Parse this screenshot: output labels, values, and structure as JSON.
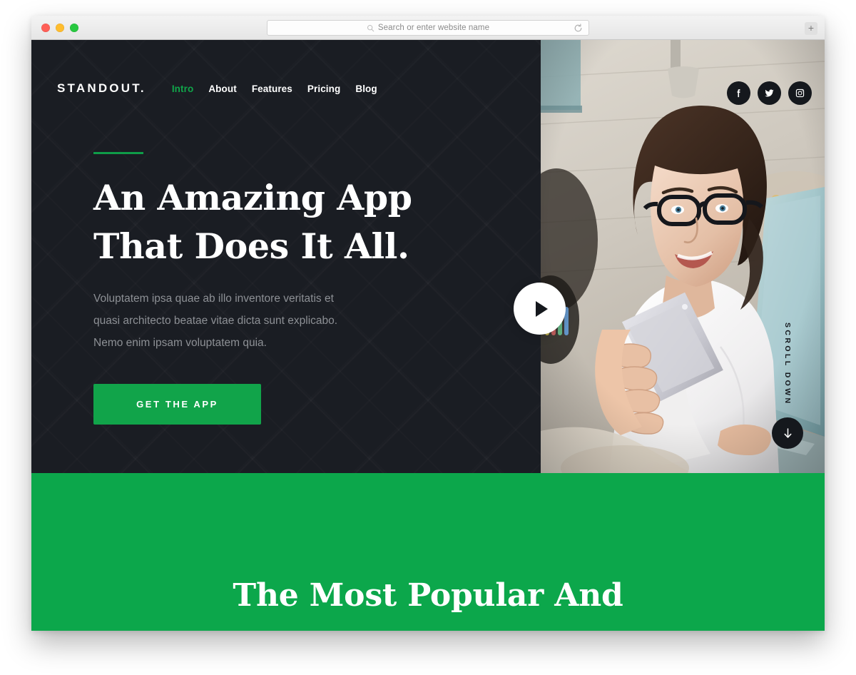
{
  "browser": {
    "traffic_lights": [
      "close",
      "minimize",
      "maximize"
    ],
    "address_placeholder": "Search or enter website name",
    "address_value": "",
    "search_icon": "search-icon",
    "reload_icon": "reload-icon",
    "new_tab_label": "+",
    "colors": {
      "close": "#ff5f57",
      "minimize": "#ffbd2e",
      "maximize": "#28c840"
    }
  },
  "site": {
    "logo": "STANDOUT.",
    "nav": [
      {
        "label": "Intro",
        "active": true
      },
      {
        "label": "About",
        "active": false
      },
      {
        "label": "Features",
        "active": false
      },
      {
        "label": "Pricing",
        "active": false
      },
      {
        "label": "Blog",
        "active": false
      }
    ],
    "socials": [
      {
        "name": "facebook-icon",
        "label": "Facebook"
      },
      {
        "name": "twitter-icon",
        "label": "Twitter"
      },
      {
        "name": "instagram-icon",
        "label": "Instagram"
      }
    ]
  },
  "hero": {
    "title": "An Amazing App\nThat Does It All.",
    "subtitle": "Voluptatem ipsa quae ab illo inventore veritatis et\nquasi architecto beatae vitae dicta sunt explicabo.\nNemo enim ipsam voluptatem quia.",
    "cta_label": "GET THE APP",
    "play_button": "play-icon",
    "scroll_label": "SCROLL DOWN",
    "scroll_arrow": "arrow-down-icon",
    "photo_alt": "Woman with glasses holding a smartphone in front of a laptop"
  },
  "green_section": {
    "heading": "The Most Popular And"
  },
  "theme": {
    "accent_green": "#0ca74b",
    "nav_active_green": "#10a64a",
    "button_green": "#11a44a",
    "dark_bg": "#1a1d23",
    "text_white": "#ffffff",
    "muted_text": "#8d9095"
  }
}
